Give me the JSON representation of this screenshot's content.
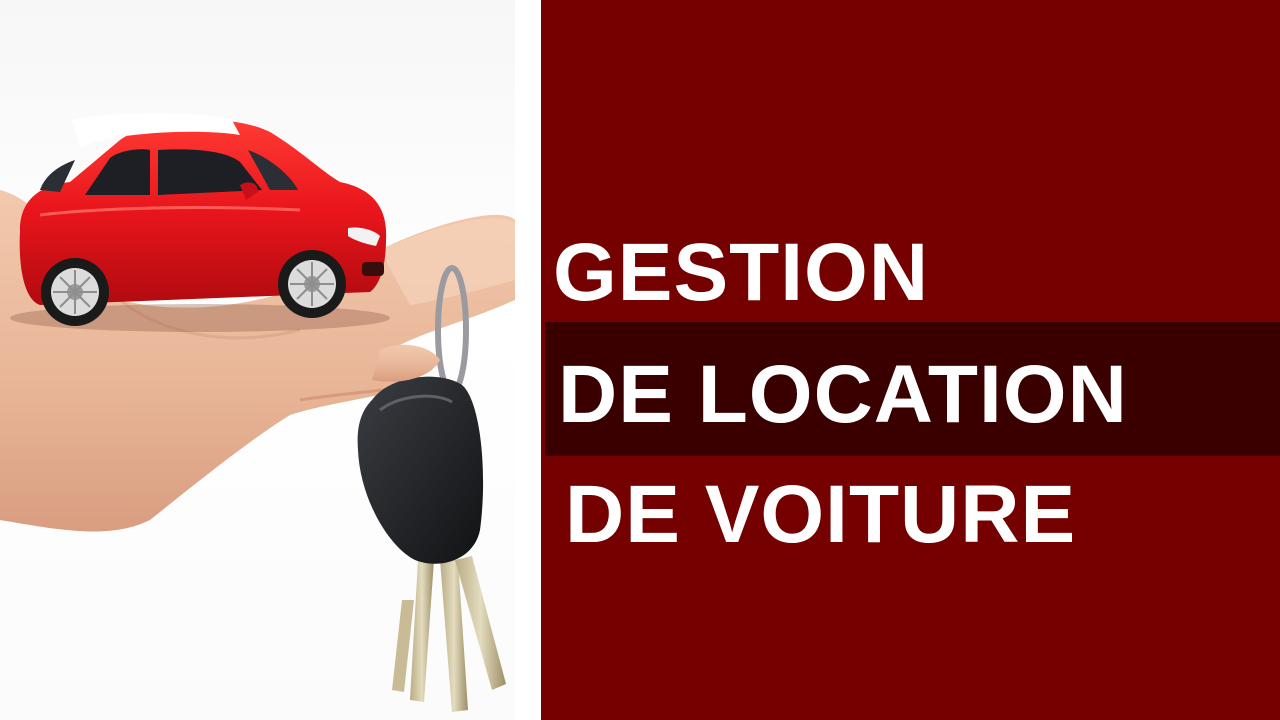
{
  "title": {
    "line1": "GESTION",
    "line2": "DE LOCATION",
    "line3": "DE VOITURE"
  },
  "colors": {
    "panel": "#740000",
    "band": "#3a0000",
    "car": "#e8151b",
    "text": "#ffffff"
  },
  "photo": {
    "icon": "hand-holding-red-car-and-keys"
  }
}
